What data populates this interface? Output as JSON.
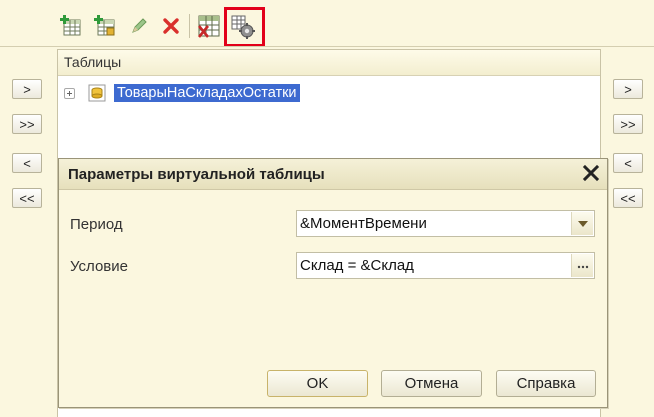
{
  "toolbar": {
    "buttons": [
      {
        "name": "add-table-icon",
        "color": "#2f9a3a"
      },
      {
        "name": "add-nested-table-icon",
        "color": "#2f9a3a"
      },
      {
        "name": "edit-pencil-icon",
        "color": "#7cb36a"
      },
      {
        "name": "delete-x-icon",
        "color": "#d9302c"
      },
      {
        "name": "replace-table-icon",
        "color": "#c62828"
      },
      {
        "name": "virtual-table-parameters-icon",
        "color": "#555555"
      }
    ],
    "highlight_color": "#e2001a"
  },
  "left_side_buttons": [
    ">",
    ">>",
    "<",
    "<<"
  ],
  "right_side_buttons": [
    ">",
    ">>",
    "<",
    "<<"
  ],
  "tables_panel": {
    "header": "Таблицы",
    "items": [
      {
        "label": "ТоварыНаСкладахОстатки",
        "selected": true,
        "expanded": false,
        "icon": "table-icon"
      }
    ]
  },
  "dialog": {
    "title": "Параметры виртуальной таблицы",
    "period_label": "Период",
    "period_value": "&МоментВремени",
    "condition_label": "Условие",
    "condition_value": "Склад = &Склад",
    "ok_label": "OK",
    "cancel_label": "Отмена",
    "help_label": "Справка"
  },
  "colors": {
    "background": "#fbf7df",
    "selection": "#3d6ad0"
  }
}
